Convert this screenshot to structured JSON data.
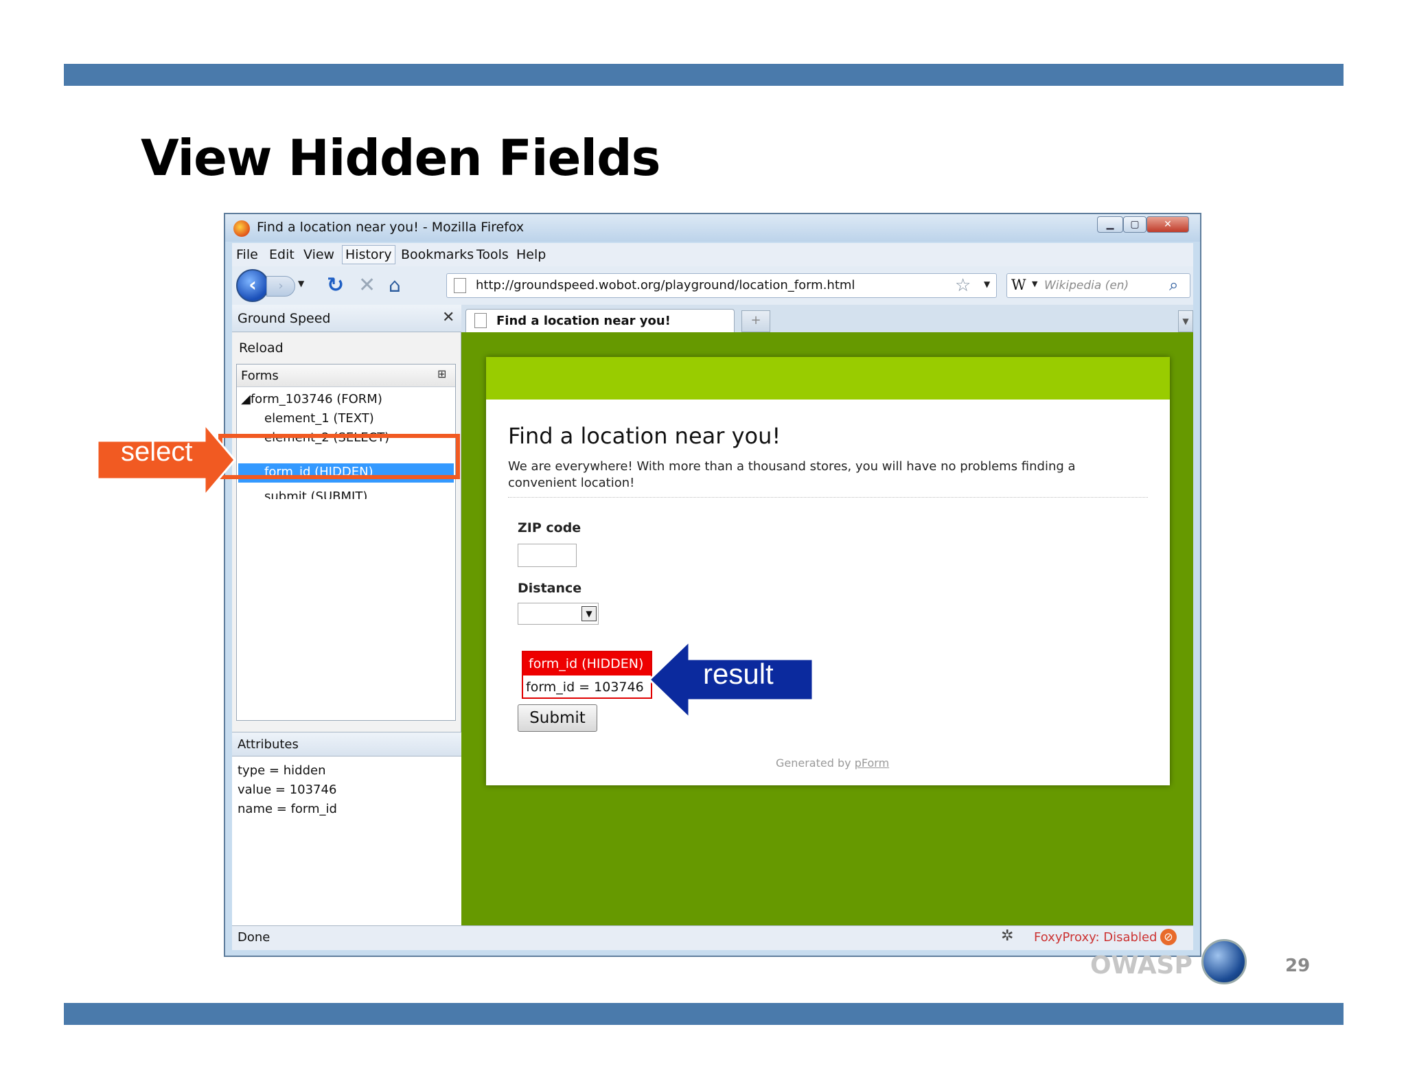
{
  "slide": {
    "title": "View Hidden Fields",
    "page_number": "29",
    "footer_logo_text": "OWASP"
  },
  "window": {
    "title": "Find a location near you! - Mozilla Firefox"
  },
  "menu": [
    "File",
    "Edit",
    "View",
    "History",
    "Bookmarks",
    "Tools",
    "Help"
  ],
  "toolbar": {
    "url": "http://groundspeed.wobot.org/playground/location_form.html",
    "search_placeholder": "Wikipedia (en)",
    "search_engine_icon": "W"
  },
  "sidebar": {
    "title": "Ground Speed",
    "reload": "Reload",
    "forms_label": "Forms",
    "tree": [
      "◢form_103746 (FORM)",
      "element_1 (TEXT)",
      "element_2 (SELECT)",
      "form_id (HIDDEN)",
      "submit (SUBMIT)"
    ],
    "attributes_title": "Attributes",
    "attributes": [
      "type = hidden",
      "value = 103746",
      "name = form_id"
    ]
  },
  "tab": {
    "label": "Find a location near you!",
    "new_tab": "+"
  },
  "page": {
    "heading": "Find a location near you!",
    "intro": "We are everywhere! With more than a thousand stores, you will have no problems finding a convenient location!",
    "zip_label": "ZIP code",
    "distance_label": "Distance",
    "hidden_head": "form_id (HIDDEN)",
    "hidden_value": "form_id = 103746",
    "submit": "Submit",
    "generated_by": "Generated by ",
    "generated_link": "pForm"
  },
  "status": {
    "left": "Done",
    "foxyproxy": "FoxyProxy: Disabled"
  },
  "annotations": {
    "select": "select",
    "result": "result",
    "select_color": "#f15a22",
    "result_color": "#0b2a9e"
  }
}
